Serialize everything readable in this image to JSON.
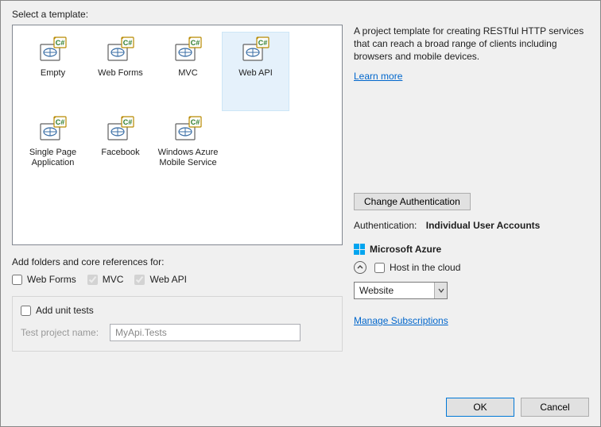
{
  "labels": {
    "select_template": "Select a template:",
    "add_folders": "Add folders and core references for:",
    "add_unit_tests": "Add unit tests",
    "test_project_name": "Test project name:",
    "test_project_value": "MyApi.Tests",
    "change_auth": "Change Authentication",
    "authentication": "Authentication:",
    "auth_value": "Individual User Accounts",
    "azure_title": "Microsoft Azure",
    "host_in_cloud": "Host in the cloud",
    "combo_value": "Website",
    "manage_subs": "Manage Subscriptions",
    "learn_more": "Learn more",
    "ok": "OK",
    "cancel": "Cancel"
  },
  "description": "A project template for creating RESTful HTTP services that can reach a broad range of clients including browsers and mobile devices.",
  "templates": [
    {
      "id": "empty",
      "label": "Empty"
    },
    {
      "id": "webforms",
      "label": "Web Forms"
    },
    {
      "id": "mvc",
      "label": "MVC"
    },
    {
      "id": "webapi",
      "label": "Web API",
      "selected": true
    },
    {
      "id": "spa",
      "label": "Single Page Application"
    },
    {
      "id": "facebook",
      "label": "Facebook"
    },
    {
      "id": "wams",
      "label": "Windows Azure Mobile Service"
    }
  ],
  "core_refs": {
    "web_forms": {
      "label": "Web Forms",
      "checked": false,
      "enabled": true
    },
    "mvc": {
      "label": "MVC",
      "checked": true,
      "enabled": false
    },
    "web_api": {
      "label": "Web API",
      "checked": true,
      "enabled": false
    }
  }
}
